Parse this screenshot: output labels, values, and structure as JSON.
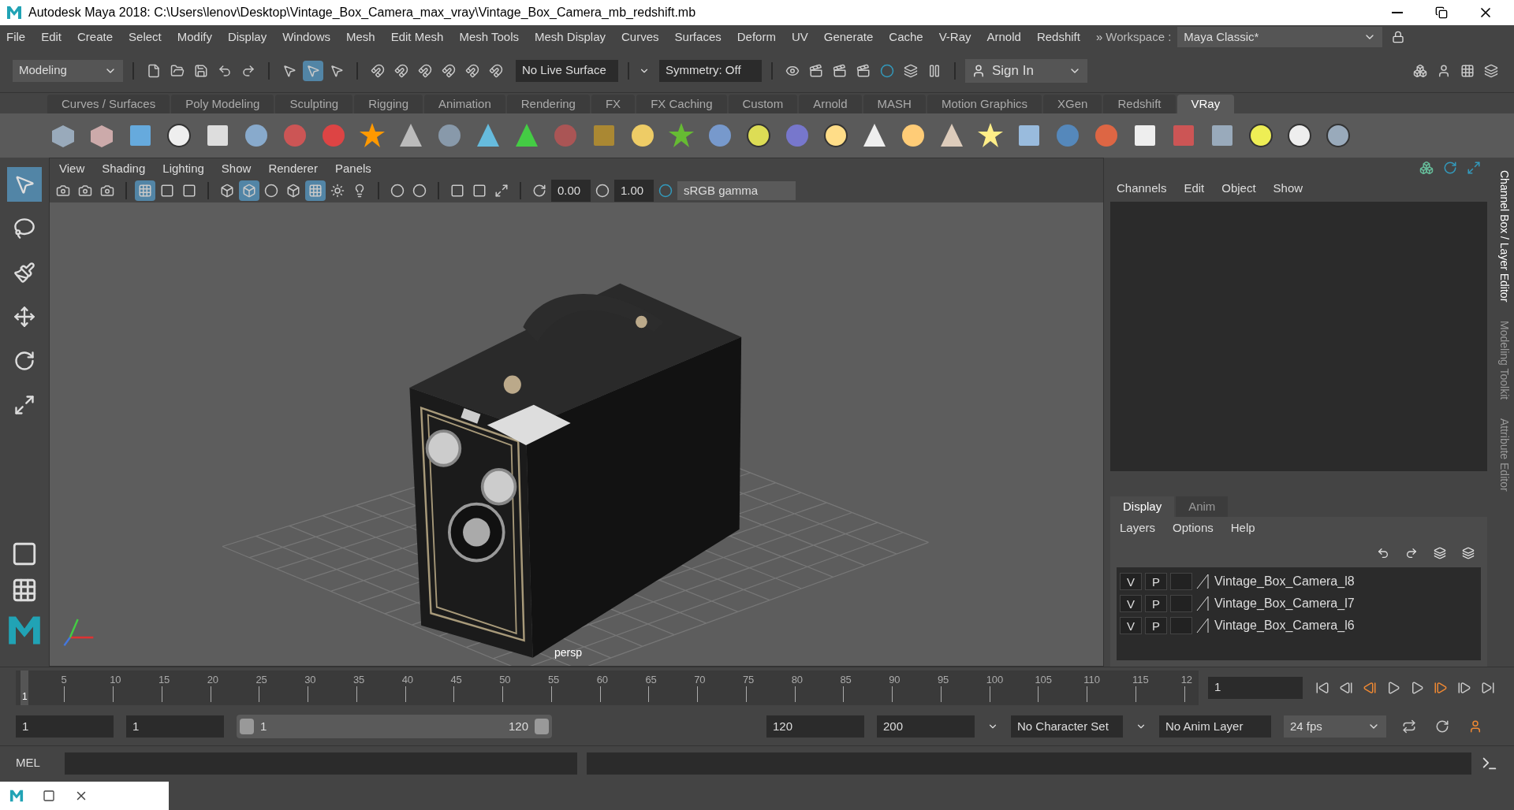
{
  "window": {
    "title": "Autodesk Maya 2018: C:\\Users\\lenov\\Desktop\\Vintage_Box_Camera_max_vray\\Vintage_Box_Camera_mb_redshift.mb"
  },
  "menu": [
    "File",
    "Edit",
    "Create",
    "Select",
    "Modify",
    "Display",
    "Windows",
    "Mesh",
    "Edit Mesh",
    "Mesh Tools",
    "Mesh Display",
    "Curves",
    "Surfaces",
    "Deform",
    "UV",
    "Generate",
    "Cache",
    "V-Ray",
    "Arnold",
    "Redshift"
  ],
  "workspace": {
    "chevron": "»",
    "label": "Workspace :",
    "value": "Maya Classic*"
  },
  "status_line": {
    "menu_set": "Modeling",
    "selection_modes": [
      {
        "selected": false
      },
      {
        "selected": true
      },
      {
        "selected": false
      }
    ],
    "live_surface": "No Live Surface",
    "symmetry": "Symmetry: Off",
    "sign_in": "Sign In"
  },
  "shelf_tabs": [
    {
      "label": "Curves / Surfaces",
      "selected": false
    },
    {
      "label": "Poly Modeling",
      "selected": false
    },
    {
      "label": "Sculpting",
      "selected": false
    },
    {
      "label": "Rigging",
      "selected": false
    },
    {
      "label": "Animation",
      "selected": false
    },
    {
      "label": "Rendering",
      "selected": false
    },
    {
      "label": "FX",
      "selected": false
    },
    {
      "label": "FX Caching",
      "selected": false
    },
    {
      "label": "Custom",
      "selected": false
    },
    {
      "label": "Arnold",
      "selected": false
    },
    {
      "label": "MASH",
      "selected": false
    },
    {
      "label": "Motion Graphics",
      "selected": false
    },
    {
      "label": "XGen",
      "selected": false
    },
    {
      "label": "Redshift",
      "selected": false
    },
    {
      "label": "VRay",
      "selected": true
    }
  ],
  "toolbox": {
    "tools": [
      {
        "selected": true
      },
      {
        "selected": false
      },
      {
        "selected": false
      },
      {
        "selected": false
      },
      {
        "selected": false
      },
      {
        "selected": false
      }
    ]
  },
  "viewport": {
    "menu": [
      "View",
      "Shading",
      "Lighting",
      "Show",
      "Renderer",
      "Panels"
    ],
    "shading_modes": [
      {
        "selected": false
      },
      {
        "selected": true
      },
      {
        "selected": false
      },
      {
        "selected": false
      },
      {
        "selected": true
      }
    ],
    "exposure": "0.00",
    "gamma": "1.00",
    "color_space": "sRGB gamma",
    "camera": "persp"
  },
  "channel_box": {
    "menu": [
      "Channels",
      "Edit",
      "Object",
      "Show"
    ]
  },
  "layer_editor": {
    "tabs": [
      {
        "label": "Display",
        "selected": true
      },
      {
        "label": "Anim",
        "selected": false
      }
    ],
    "menu": [
      "Layers",
      "Options",
      "Help"
    ],
    "layers": [
      {
        "visible": "V",
        "playback": "P",
        "name": "Vintage_Box_Camera_l8"
      },
      {
        "visible": "V",
        "playback": "P",
        "name": "Vintage_Box_Camera_l7"
      },
      {
        "visible": "V",
        "playback": "P",
        "name": "Vintage_Box_Camera_l6"
      }
    ]
  },
  "side_tabs": [
    "Channel Box / Layer Editor",
    "Modeling Toolkit",
    "Attribute Editor"
  ],
  "timeline": {
    "level": 0,
    "marker": "1",
    "ticks": [
      "5",
      "10",
      "15",
      "20",
      "25",
      "30",
      "35",
      "40",
      "45",
      "50",
      "55",
      "60",
      "65",
      "70",
      "75",
      "80",
      "85",
      "90",
      "95",
      "100",
      "105",
      "110",
      "115",
      "12"
    ],
    "current_frame": "1"
  },
  "range": {
    "level": 1,
    "start": "1",
    "playback_start": "1",
    "slider_start": "1",
    "slider_end": "120",
    "playback_end": "120",
    "end": "200",
    "character_set": "No Character Set",
    "anim_layer": "No Anim Layer",
    "fps": "24 fps"
  },
  "command_line": {
    "language": "MEL"
  }
}
